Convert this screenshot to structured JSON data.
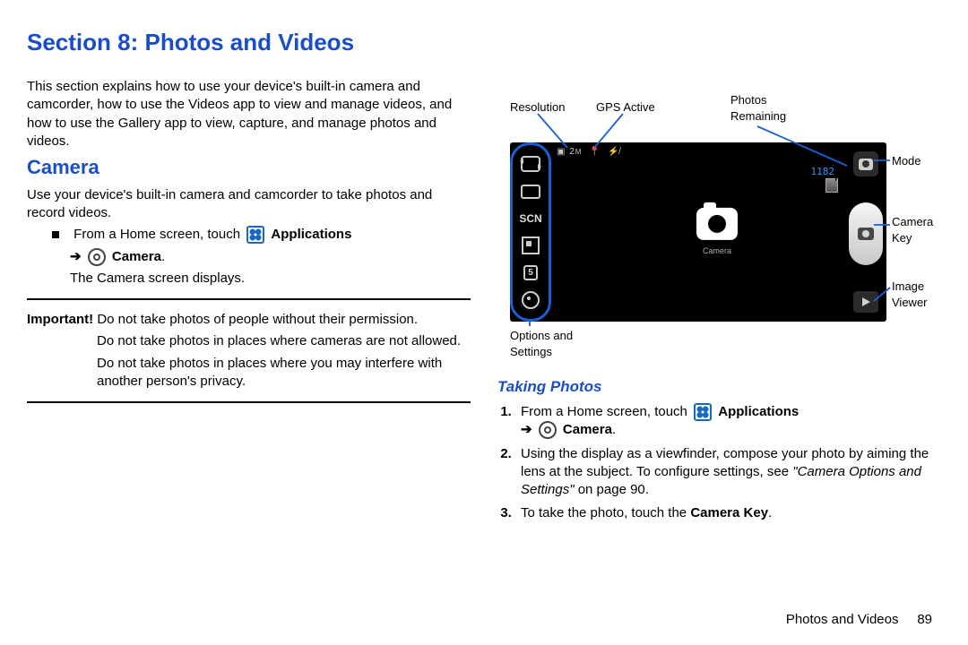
{
  "title": "Section 8: Photos and Videos",
  "intro": "This section explains how to use your device's built-in camera and camcorder, how to use the Videos app to view and manage videos, and how to use the Gallery app to view, capture, and manage photos and videos.",
  "h_camera": "Camera",
  "camera_intro": "Use your device's built-in camera and camcorder to take photos and record videos.",
  "bullet_from": "From a Home screen, touch",
  "applications": "Applications",
  "camera_label": "Camera",
  "camera_displays": "The Camera screen displays.",
  "important_label": "Important!",
  "important_1": "Do not take photos of people without their permission.",
  "important_2": "Do not take photos in places where cameras are not allowed.",
  "important_3": "Do not take photos in places where you may interfere with another person's privacy.",
  "labels": {
    "resolution": "Resolution",
    "gps": "GPS Active",
    "photos_remaining": "Photos\nRemaining",
    "mode": "Mode",
    "camera_key": "Camera\nKey",
    "image_viewer": "Image\nViewer",
    "options": "Options and\nSettings"
  },
  "sidebar": {
    "scn": "SCN",
    "timer": "5"
  },
  "remaining_count": "1182",
  "viewfinder_caption": "Camera",
  "h_taking": "Taking Photos",
  "step1_a": "From a Home screen, touch",
  "step2": "Using the display as a viewfinder, compose your photo by aiming the lens at the subject. To configure settings, see ",
  "step2_link": "\"Camera Options and Settings\"",
  "step2_tail": " on page 90.",
  "step3_a": "To take the photo, touch the ",
  "step3_b": "Camera Key",
  "footer_text": "Photos and Videos",
  "page_no": "89"
}
